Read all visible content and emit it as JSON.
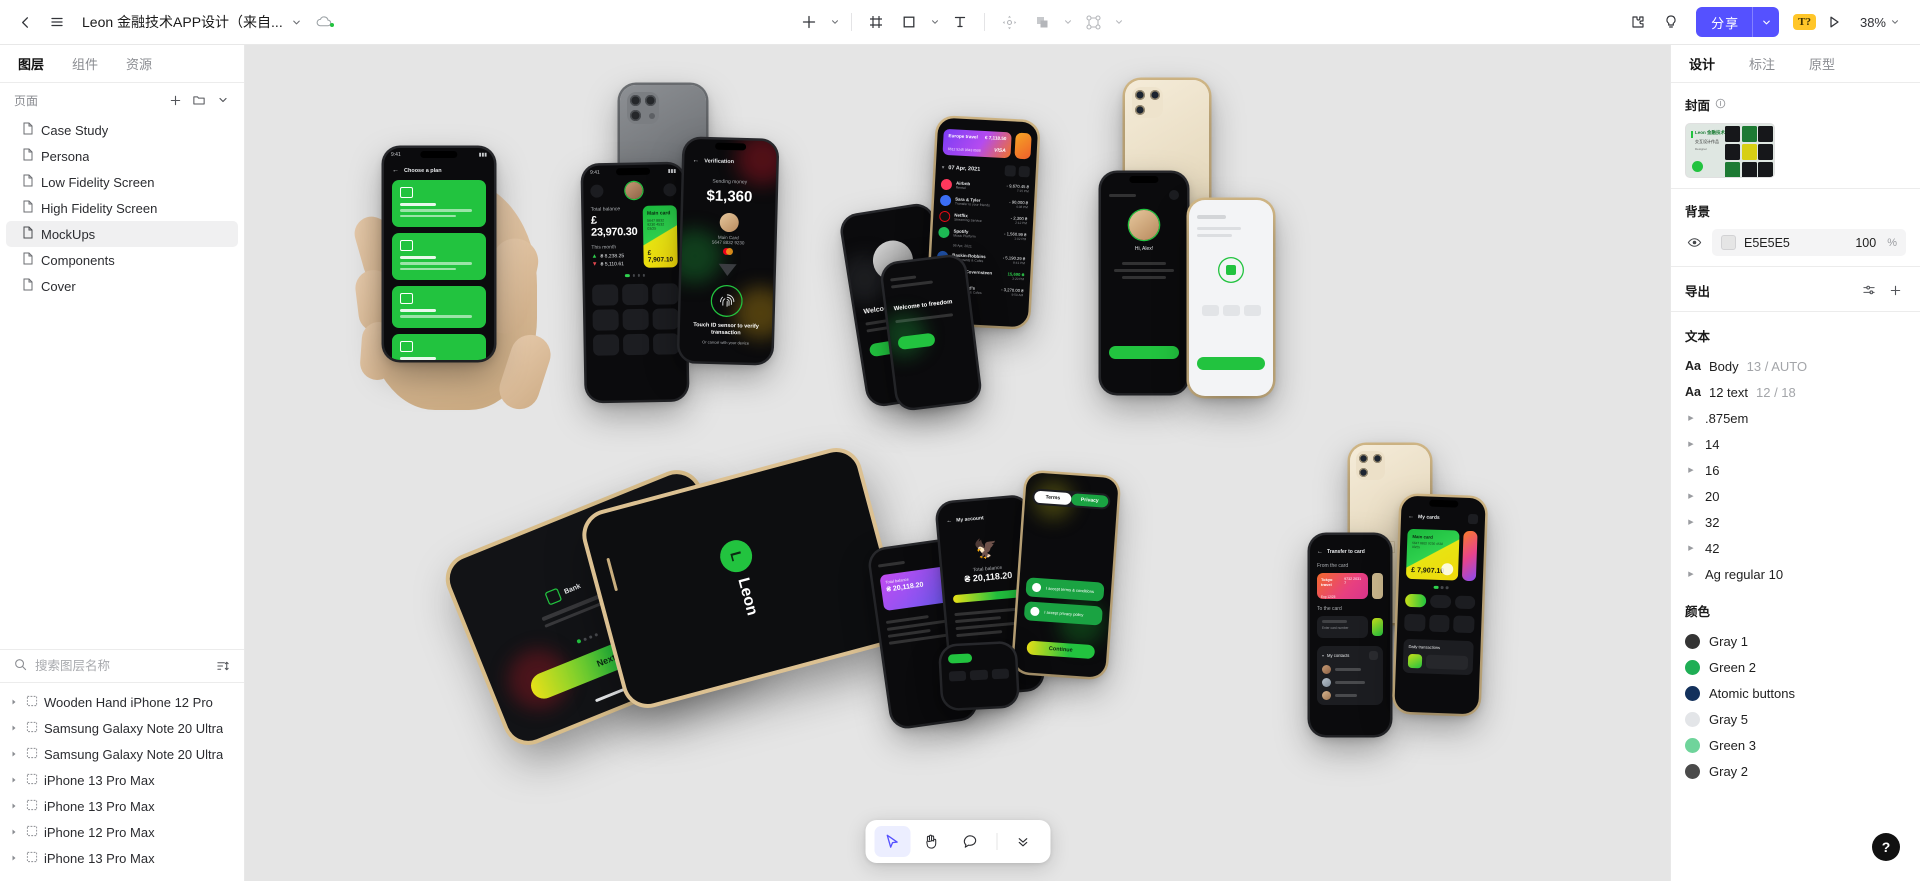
{
  "topbar": {
    "back_icon": "chevron-left-icon",
    "menu_icon": "hamburger-menu-icon",
    "doc_title": "Leon 金融技术APP设计（来自...",
    "title_caret_icon": "chevron-down-icon",
    "cloud_icon": "cloud-sync-icon",
    "tools": [
      {
        "name": "add-tool",
        "icon": "plus-icon",
        "has_caret": true
      },
      {
        "name": "frame-tool",
        "icon": "frame-icon",
        "has_caret": false
      },
      {
        "name": "shape-tool",
        "icon": "rectangle-icon",
        "has_caret": true
      },
      {
        "name": "text-tool",
        "icon": "text-t-icon",
        "has_caret": false
      },
      {
        "name": "move-tool",
        "icon": "move-gizmo-icon",
        "has_caret": false
      },
      {
        "name": "boolean-tool",
        "icon": "boolean-union-icon",
        "has_caret": true
      },
      {
        "name": "component-tool",
        "icon": "component-nodes-icon",
        "has_caret": true
      }
    ],
    "plugin_icon": "plugin-puzzle-icon",
    "idea_icon": "lightbulb-icon",
    "share_label": "分享",
    "share_caret_icon": "chevron-down-icon",
    "share_color": "#5551FF",
    "badge_label": "T?",
    "badge_color": "#FFC629",
    "play_icon": "play-preview-icon",
    "zoom_level": "38%",
    "zoom_caret_icon": "chevron-down-icon"
  },
  "left_panel": {
    "tabs": [
      {
        "label": "图层",
        "active": true
      },
      {
        "label": "组件",
        "active": false
      },
      {
        "label": "资源",
        "active": false
      }
    ],
    "pages_header": {
      "label": "页面",
      "add_icon": "plus-icon",
      "folder_icon": "folder-icon",
      "collapse_icon": "chevron-down-icon"
    },
    "pages": [
      {
        "label": "Case Study",
        "icon": "page-icon",
        "selected": false
      },
      {
        "label": "Persona",
        "icon": "page-icon",
        "selected": false
      },
      {
        "label": "Low Fidelity Screen",
        "icon": "page-icon",
        "selected": false
      },
      {
        "label": "High Fidelity Screen",
        "icon": "page-icon",
        "selected": false
      },
      {
        "label": "MockUps",
        "icon": "page-icon",
        "selected": true
      },
      {
        "label": "Components",
        "icon": "page-icon",
        "selected": false
      },
      {
        "label": "Cover",
        "icon": "page-icon",
        "selected": false
      }
    ],
    "search": {
      "placeholder": "搜索图层名称",
      "search_icon": "search-icon",
      "filter_icon": "sort-filter-icon"
    },
    "layers": [
      {
        "label": "Wooden Hand iPhone 12 Pro",
        "icon": "frame-icon",
        "disclosure": "chevron-right-icon"
      },
      {
        "label": "Samsung Galaxy Note 20 Ultra",
        "icon": "frame-icon",
        "disclosure": "chevron-right-icon"
      },
      {
        "label": "Samsung Galaxy Note 20 Ultra",
        "icon": "frame-icon",
        "disclosure": "chevron-right-icon"
      },
      {
        "label": "iPhone 13 Pro Max",
        "icon": "frame-icon",
        "disclosure": "chevron-right-icon"
      },
      {
        "label": "iPhone 13 Pro Max",
        "icon": "frame-icon",
        "disclosure": "chevron-right-icon"
      },
      {
        "label": "iPhone 12 Pro Max",
        "icon": "frame-icon",
        "disclosure": "chevron-right-icon"
      },
      {
        "label": "iPhone 13 Pro Max",
        "icon": "frame-icon",
        "disclosure": "chevron-right-icon"
      }
    ]
  },
  "canvas": {
    "background_color": "#E5E5E5",
    "mockup_text": {
      "hand_phone_title": "Choose a plan",
      "balance_label": "Total balance",
      "balance_value": "£ 23,970.30",
      "card_title": "Main card",
      "card_number": "5647 8832 9230 4532",
      "card_expiry": "03/25",
      "card_value": "£ 7,907.10",
      "verify_title": "Verification",
      "verify_sub": "Sending money",
      "verify_amount": "$1,360",
      "verify_hint": "Touch ID sensor to verify transaction",
      "travel_card_title": "Europe travel",
      "travel_card_value": "€ 7,118.50",
      "travel_card_brand": "VISA",
      "tx_date": "07 Apr, 2021",
      "transactions": [
        {
          "name": "Airbnb",
          "sub": "Rental",
          "amount": "- 9,670.45 ₴",
          "time": "7:15 PM"
        },
        {
          "name": "Sara & Tyler",
          "sub": "Transfer to your friends",
          "amount": "- 90,000 ₴",
          "time": "4:38 PM"
        },
        {
          "name": "Netflix",
          "sub": "Streaming Service",
          "amount": "- 2,300 ₴",
          "time": "2:12 PM"
        },
        {
          "name": "Spotify",
          "sub": "Music Platform",
          "amount": "- 1,560.99 ₴",
          "time": "1:02 PM"
        },
        {
          "name": "Baskin-Robbins",
          "sub": "Restaurants & Cafes",
          "amount": "- 5,190.29 ₴",
          "time": "8:41 PM"
        },
        {
          "name": "Marita Covernsteen",
          "sub": "Transfer",
          "amount": "15,690 ₴",
          "time": "3:20 PM"
        },
        {
          "name": "McDonald's",
          "sub": "Restaurants & Cafes",
          "amount": "- 3,270.00 ₴",
          "time": "9:50 AM"
        }
      ],
      "splash_brand": "Leon",
      "next_button": "Next",
      "transfer_title": "Transfer to card",
      "transfer_from": "From the card",
      "transfer_to": "To the card",
      "contacts_label": "My contacts",
      "tokyo_card": "Tokyo travel",
      "tokyo_number": "9732 2031 7",
      "my_cards_title": "My cards",
      "terms_tab": "Terms",
      "privacy_tab": "Privacy",
      "continue_button": "Continue",
      "welcome_text": "Welcome to freedom",
      "balance_secondary": "₴ 20,118.20",
      "card_secondary": "₴ 20,118.20"
    },
    "floating_toolbar": [
      {
        "name": "cursor-tool",
        "icon": "cursor-arrow-icon",
        "active": true
      },
      {
        "name": "hand-tool",
        "icon": "hand-icon",
        "active": false
      },
      {
        "name": "comment-tool",
        "icon": "comment-bubble-icon",
        "active": false
      },
      {
        "name": "more-tools",
        "icon": "double-chevron-down-icon",
        "active": false
      }
    ],
    "help_label": "?"
  },
  "right_panel": {
    "tabs": [
      {
        "label": "设计",
        "active": true
      },
      {
        "label": "标注",
        "active": false
      },
      {
        "label": "原型",
        "active": false
      }
    ],
    "cover": {
      "title": "封面",
      "info_icon": "info-icon",
      "thumb_title": "Leon 金融技术APP",
      "thumb_sub": "交互设计作品",
      "thumb_meta": "Designer"
    },
    "background": {
      "title": "背景",
      "eye_icon": "eye-visible-icon",
      "hex": "E5E5E5",
      "opacity": "100",
      "pct": "%"
    },
    "export": {
      "title": "导出",
      "settings_icon": "sliders-icon",
      "add_icon": "plus-icon"
    },
    "text_section": {
      "title": "文本",
      "named_styles": [
        {
          "aa": "Aa",
          "name": "Body",
          "meta": "13 / AUTO"
        },
        {
          "aa": "Aa",
          "name": "12 text",
          "meta": "12 / 18"
        }
      ],
      "groups": [
        ".875em",
        "14",
        "16",
        "20",
        "32",
        "42",
        "Ag regular 10"
      ]
    },
    "color_section": {
      "title": "颜色",
      "colors": [
        {
          "label": "Gray 1",
          "hex": "#343434"
        },
        {
          "label": "Green 2",
          "hex": "#1FAE55"
        },
        {
          "label": "Atomic buttons",
          "hex": "#13315C"
        },
        {
          "label": "Gray 5",
          "hex": "#E3E5E8"
        },
        {
          "label": "Green 3",
          "hex": "#6FD49B"
        },
        {
          "label": "Gray 2",
          "hex": "#4A4A4A"
        }
      ]
    }
  }
}
